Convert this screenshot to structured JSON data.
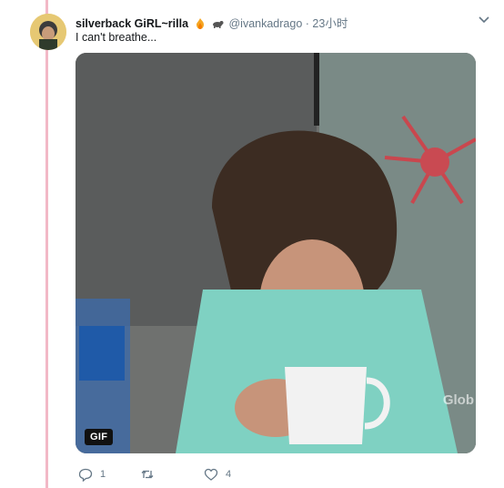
{
  "tweet": {
    "display_name": "silverback GiRL~rilla",
    "handle": "@ivankadrago",
    "time": "23小时",
    "text": "I can't breathe...",
    "separator": "·"
  },
  "media": {
    "badge": "GIF",
    "watermark": "Glob"
  },
  "actions": {
    "reply_count": "1",
    "retweet_count": "",
    "like_count": "4"
  },
  "colors": {
    "thread_line": "#f2b8c6",
    "muted_text": "#657786",
    "primary_text": "#14171a"
  }
}
